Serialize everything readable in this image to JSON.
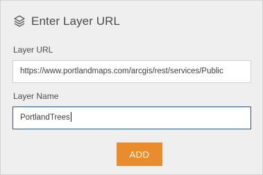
{
  "panel": {
    "title": "Enter Layer URL",
    "icon": "layers-icon"
  },
  "form": {
    "url_label": "Layer URL",
    "url_value": "https://www.portlandmaps.com/arcgis/rest/services/Public",
    "name_label": "Layer Name",
    "name_value": "PortlandTrees"
  },
  "actions": {
    "add_label": "ADD"
  },
  "colors": {
    "accent": "#e88c2d",
    "focus_border": "#34536f",
    "panel_bg": "#efefef"
  }
}
